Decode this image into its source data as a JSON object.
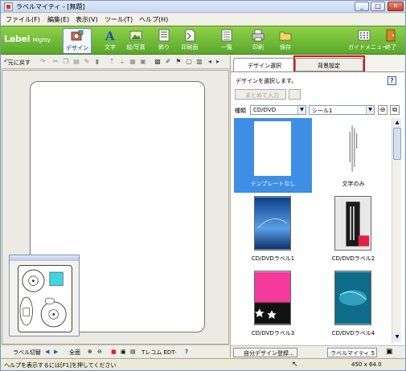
{
  "window": {
    "title": "ラベルマイティ - [無題]"
  },
  "menu": [
    "ファイル(F)",
    "編集(E)",
    "表示(V)",
    "ツール(T)",
    "ヘルプ(H)"
  ],
  "toolbar": {
    "logo": "Label",
    "logo_small": "Mighty",
    "tools": [
      {
        "label": "デザイン",
        "icon": "design-icon"
      },
      {
        "label": "文字",
        "icon": "text-icon"
      },
      {
        "label": "絵/写真",
        "icon": "picture-icon"
      },
      {
        "label": "飾り",
        "icon": "decoration-icon"
      },
      {
        "label": "印刷面",
        "icon": "print-face-icon"
      },
      {
        "label": "一覧",
        "icon": "list-icon"
      },
      {
        "label": "印刷",
        "icon": "printer-icon"
      },
      {
        "label": "保存",
        "icon": "folder-icon"
      },
      {
        "label": "ガイドメニュー",
        "icon": "guide-menu-icon"
      },
      {
        "label": "終了",
        "icon": "exit-icon"
      }
    ]
  },
  "left": {
    "undo": "元に戻す",
    "bottom": {
      "switch": "ラベル切替",
      "whole": "全面",
      "tecom": "Tレコム EDT-"
    }
  },
  "right": {
    "tabs": {
      "design": "デザイン選択",
      "background": "背景設定"
    },
    "hint": "デザインを選択します。",
    "help": "?",
    "batch": "まとめて入力",
    "filter_label": "種類",
    "type_value": "CD/DVD",
    "sheet_value": "シール1",
    "designs": [
      {
        "caption": "テンプレートなし"
      },
      {
        "caption": "文字のみ"
      },
      {
        "caption": "CD/DVDラベル1"
      },
      {
        "caption": "CD/DVDラベル2"
      },
      {
        "caption": "CD/DVDラベル3"
      },
      {
        "caption": "CD/DVDラベル4"
      }
    ],
    "register": "自分デザイン登録...",
    "sheet_name": "ラベルマイティ 5"
  },
  "status": {
    "text": "ヘルプを表示するには[F1]を押してください",
    "size": "450 x 64.0"
  },
  "colors": {
    "toolbar_green": "#6fc036",
    "selection_blue": "#3e8ee5",
    "highlight_red": "#e01010"
  }
}
